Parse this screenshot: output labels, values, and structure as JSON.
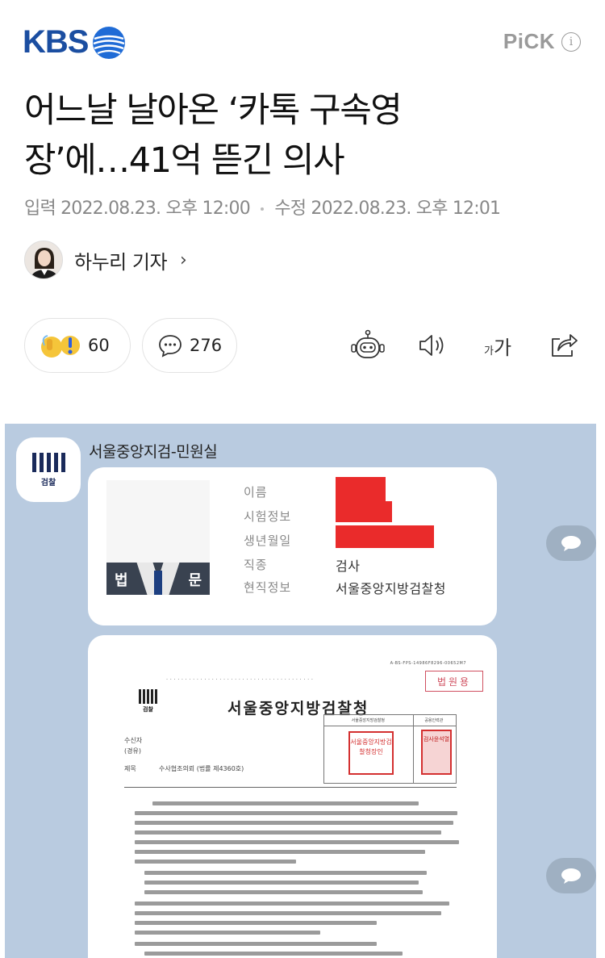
{
  "header": {
    "brand": "KBS",
    "pick_label": "PiCK",
    "info_glyph": "i"
  },
  "article": {
    "title_line1": "어느날 날아온 ‘카톡 구속영",
    "title_line2": "장’에…41억 뜯긴 의사",
    "input_label": "입력",
    "input_time": "2022.08.23. 오후 12:00",
    "edit_label": "수정",
    "edit_time": "2022.08.23. 오후 12:01",
    "reporter": "하누리 기자"
  },
  "actions": {
    "reaction_count": "60",
    "comment_count": "276",
    "font_size_label_small": "가",
    "font_size_label_large": "가",
    "icons": [
      "reaction-icon",
      "comment-icon",
      "summary-bot-icon",
      "listen-icon",
      "font-size-icon",
      "share-icon"
    ]
  },
  "image": {
    "sender": "서울중앙지검-민원실",
    "profile_label": "검찰",
    "id_card": {
      "fields": [
        {
          "label": "이름",
          "value": ""
        },
        {
          "label": "시험정보",
          "value": ""
        },
        {
          "label": "생년월일",
          "value": ""
        },
        {
          "label": "직종",
          "value": "검사"
        },
        {
          "label": "현직정보",
          "value": "서울중앙지방검찰청"
        }
      ],
      "watermark_left": "법",
      "watermark_right": "문"
    },
    "document": {
      "code": "A-BS-FPS-14986F8296-00652M7",
      "copy_stamp": "법원용",
      "logo_label": "검찰",
      "title": "서울중앙지방검찰청",
      "recipient_label": "수신자",
      "recipient_value": "(경유)",
      "subject_label": "제목",
      "subject_value": "수사협조의뢰 (법률 제4360호)",
      "stamp_header_left": "서울중앙지방검찰청",
      "stamp_header_right": "공용인력관",
      "stamp_left_text": "서울중앙지방검찰청장인",
      "stamp_right_text": "검사윤석열"
    }
  },
  "colors": {
    "brand": "#1b4ea1",
    "image_bg": "#b9cbe0",
    "redaction": "#ea2b2b"
  }
}
